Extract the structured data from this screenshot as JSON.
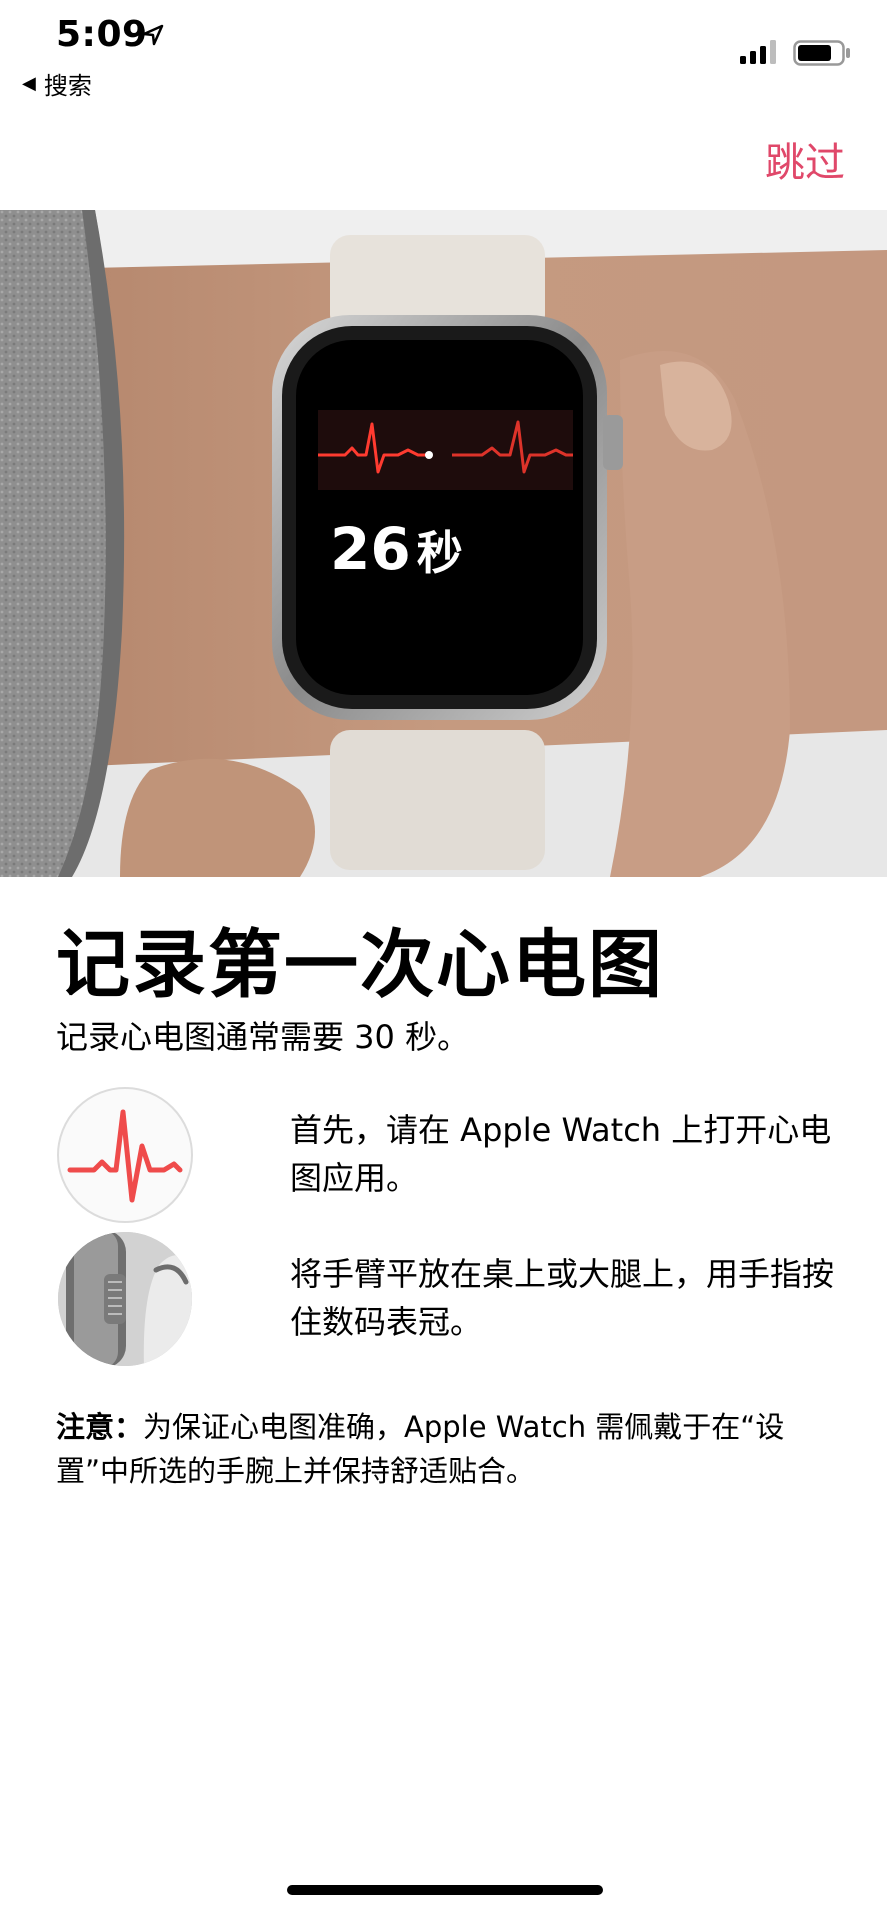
{
  "status_bar": {
    "time": "5:09",
    "back_label": "搜索"
  },
  "nav": {
    "skip_label": "跳过",
    "accent_color": "#e0486a"
  },
  "hero": {
    "watch_timer_value": "26",
    "watch_timer_unit": "秒"
  },
  "content": {
    "title": "记录第一次心电图",
    "subtitle": "记录心电图通常需要 30 秒。",
    "steps": [
      {
        "icon": "ecg-app-icon",
        "text": "首先，请在 Apple Watch 上打开心电图应用。"
      },
      {
        "icon": "digital-crown-icon",
        "text": "将手臂平放在桌上或大腿上，用手指按住数码表冠。"
      }
    ],
    "note_label": "注意：",
    "note_text": "为保证心电图准确，Apple Watch 需佩戴于在“设置”中所选的手腕上并保持舒适贴合。"
  }
}
